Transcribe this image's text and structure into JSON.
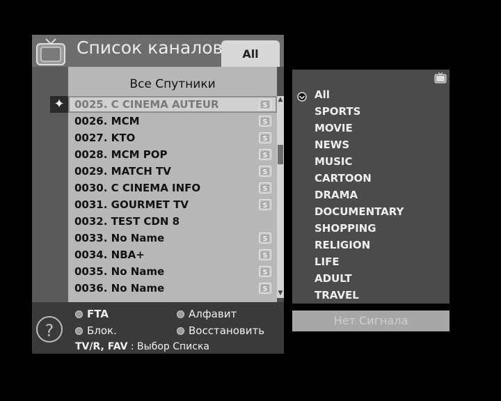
{
  "header": {
    "title": "Список каналов",
    "tab_label": "All"
  },
  "list": {
    "header": "Все Спутники",
    "selected_index": 0,
    "rows": [
      {
        "label": "0025. C CINEMA AUTEUR",
        "badge": true
      },
      {
        "label": "0026. MCM",
        "badge": true
      },
      {
        "label": "0027. KTO",
        "badge": true
      },
      {
        "label": "0028. MCM POP",
        "badge": true
      },
      {
        "label": "0029. MATCH TV",
        "badge": true
      },
      {
        "label": "0030. C CINEMA INFO",
        "badge": true
      },
      {
        "label": "0031. GOURMET TV",
        "badge": true
      },
      {
        "label": "0032. TEST CDN 8",
        "badge": false
      },
      {
        "label": "0033. No Name",
        "badge": true
      },
      {
        "label": "0034. NBA+",
        "badge": true
      },
      {
        "label": "0035. No Name",
        "badge": true
      },
      {
        "label": "0036. No Name",
        "badge": true
      }
    ]
  },
  "footer": {
    "fta": "FTA",
    "alphabet": "Алфавит",
    "block": "Блок.",
    "restore": "Восстановить",
    "hint_keys": "TV/R, FAV",
    "hint_text": " : Выбор Списка"
  },
  "genres": {
    "selected_index": 0,
    "items": [
      "All",
      "SPORTS",
      "MOVIE",
      "NEWS",
      "MUSIC",
      "CARTOON",
      "DRAMA",
      "DOCUMENTARY",
      "SHOPPING",
      "RELIGION",
      "LIFE",
      "ADULT",
      "TRAVEL"
    ]
  },
  "status": {
    "no_signal": "Нет Сигнала"
  },
  "icons": {
    "tv": "tv-icon",
    "help": "help-icon",
    "cursor": "cursor-star-icon",
    "scrambled": "scrambled-s-icon",
    "selected_genre": "radio-selected-icon"
  },
  "colors": {
    "list_bg": "#b7b7b7",
    "panel_bg": "#4f4f4f",
    "status_bg": "#a7a7a7"
  }
}
